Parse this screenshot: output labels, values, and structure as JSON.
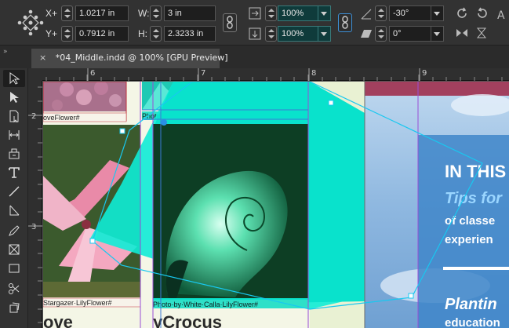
{
  "control_panel": {
    "x_label": "X+",
    "x_value": "1.0217 in",
    "y_label": "Y+",
    "y_value": "0.7912 in",
    "w_label": "W:",
    "w_value": "3 in",
    "h_label": "H:",
    "h_value": "2.3233 in",
    "scale_x_value": "100%",
    "scale_y_value": "100%",
    "rotate_value": "-30°",
    "shear_value": "0°"
  },
  "tab": {
    "close_glyph": "×",
    "title": "*04_Middle.indd @ 100% [GPU Preview]"
  },
  "rulers": {
    "top": [
      "6",
      "7",
      "8",
      "9"
    ],
    "left": [
      "2",
      "3"
    ]
  },
  "document": {
    "caption_foxglove": "oveFlower#",
    "caption_crocus": "Photo·by·Purple·CrocusFlower#",
    "caption_stargazer": "Stargazer·LilyFlower#",
    "caption_calla": "Photo·by·White·Calla·LilyFlower#",
    "headline_left_fragment": "ove",
    "headline_mid_fragment": "yCrocus",
    "panel_heading": "IN THIS",
    "panel_sub": "Tips for",
    "panel_line1": "of classe",
    "panel_line2": "experien",
    "panel_heading2": "Plantin",
    "panel_line3": "education"
  },
  "colors": {
    "accent_teal": "#00e0c8",
    "selection_cyan": "#18c8f0",
    "banner_red": "#a2405e",
    "panel_blue": "#3f86c9"
  },
  "icons": {
    "tools": [
      "selection-tool-icon",
      "direct-selection-tool-icon",
      "page-tool-icon",
      "gap-tool-icon",
      "content-collector-icon",
      "type-tool-icon",
      "line-tool-icon",
      "pen-tool-icon",
      "pencil-tool-icon",
      "rectangle-frame-tool-icon",
      "rectangle-tool-icon",
      "scissors-tool-icon",
      "free-transform-tool-icon"
    ]
  }
}
